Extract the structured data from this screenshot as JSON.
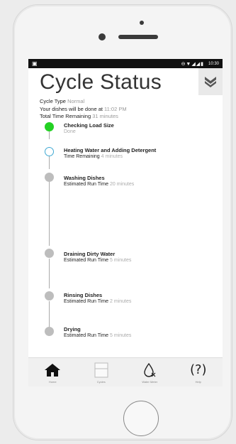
{
  "statusbar": {
    "time": "10:30"
  },
  "header": {
    "title": "Cycle Status"
  },
  "info": {
    "cycle_type_label": "Cycle Type",
    "cycle_type_value": "Normal",
    "done_label": "Your dishes will be done at",
    "done_value": "11:02 PM",
    "remaining_label": "Total Time Remaining",
    "remaining_value": "31 minutes"
  },
  "steps": [
    {
      "title": "Checking Load Size",
      "sub_label": "",
      "sub_value": "Done",
      "state": "done"
    },
    {
      "title": "Heating Water and Adding Detergent",
      "sub_label": "Time Remaining",
      "sub_value": "4 minutes",
      "state": "active"
    },
    {
      "title": "Washing Dishes",
      "sub_label": "Estimated Run Time",
      "sub_value": "20 minutes",
      "state": "pending"
    },
    {
      "title": "Draining Dirty Water",
      "sub_label": "Estimated Run Time",
      "sub_value": "5 minutes",
      "state": "pending"
    },
    {
      "title": "Rinsing Dishes",
      "sub_label": "Estimated Run Time",
      "sub_value": "2 minutes",
      "state": "pending"
    },
    {
      "title": "Drying",
      "sub_label": "Estimated Run Time",
      "sub_value": "5 minutes",
      "state": "pending"
    }
  ],
  "tabs": [
    {
      "label": "Home",
      "icon": "home-icon"
    },
    {
      "label": "Cycles",
      "icon": "cycles-icon"
    },
    {
      "label": "Water Meter",
      "icon": "water-drop-icon"
    },
    {
      "label": "Help",
      "icon": "help-icon"
    }
  ],
  "colors": {
    "done": "#23d123",
    "active": "#3fa9d3",
    "pending": "#bdbdbd"
  }
}
